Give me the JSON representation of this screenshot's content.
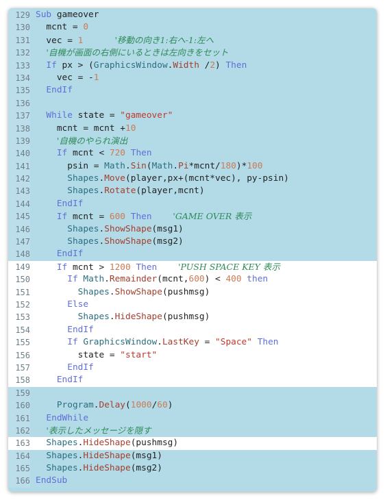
{
  "colors": {
    "background": "#b3dae7",
    "highlight": "#ffffff",
    "keyword": "#5f6fd8",
    "number": "#c97b55",
    "class": "#2b6f80",
    "method": "#a2402e",
    "string": "#c0392b",
    "comment": "#2e8b57"
  },
  "lines": [
    {
      "n": "129",
      "hl": false,
      "t": [
        [
          "kw",
          "Sub"
        ],
        [
          "pl",
          " gameover"
        ]
      ]
    },
    {
      "n": "130",
      "hl": false,
      "t": [
        [
          "pl",
          "  mcnt = "
        ],
        [
          "num",
          "0"
        ]
      ]
    },
    {
      "n": "131",
      "hl": false,
      "t": [
        [
          "pl",
          "  vec = "
        ],
        [
          "num",
          "1"
        ],
        [
          "pl",
          "      "
        ],
        [
          "cm",
          "'移動の向き1:右へ-1:左へ"
        ]
      ]
    },
    {
      "n": "132",
      "hl": false,
      "t": [
        [
          "pl",
          "  "
        ],
        [
          "cm",
          "'自機が画面の右側にいるときは左向きをセット"
        ]
      ]
    },
    {
      "n": "133",
      "hl": false,
      "t": [
        [
          "pl",
          "  "
        ],
        [
          "kw",
          "If"
        ],
        [
          "pl",
          " px > ("
        ],
        [
          "cls",
          "GraphicsWindow"
        ],
        [
          "pl",
          "."
        ],
        [
          "mth",
          "Width"
        ],
        [
          "pl",
          " /"
        ],
        [
          "num",
          "2"
        ],
        [
          "pl",
          ") "
        ],
        [
          "kw",
          "Then"
        ]
      ]
    },
    {
      "n": "134",
      "hl": false,
      "t": [
        [
          "pl",
          "    vec = -"
        ],
        [
          "num",
          "1"
        ]
      ]
    },
    {
      "n": "135",
      "hl": false,
      "t": [
        [
          "pl",
          "  "
        ],
        [
          "kw",
          "EndIf"
        ]
      ]
    },
    {
      "n": "136",
      "hl": false,
      "t": []
    },
    {
      "n": "137",
      "hl": false,
      "t": [
        [
          "pl",
          "  "
        ],
        [
          "kw",
          "While"
        ],
        [
          "pl",
          " state = "
        ],
        [
          "str",
          "\"gameover\""
        ]
      ]
    },
    {
      "n": "138",
      "hl": false,
      "t": [
        [
          "pl",
          "    mcnt = mcnt +"
        ],
        [
          "num",
          "10"
        ]
      ]
    },
    {
      "n": "139",
      "hl": false,
      "t": [
        [
          "pl",
          "    "
        ],
        [
          "cm",
          "'自機のやられ演出"
        ]
      ]
    },
    {
      "n": "140",
      "hl": false,
      "t": [
        [
          "pl",
          "    "
        ],
        [
          "kw",
          "If"
        ],
        [
          "pl",
          " mcnt < "
        ],
        [
          "num",
          "720"
        ],
        [
          "pl",
          " "
        ],
        [
          "kw",
          "Then"
        ]
      ]
    },
    {
      "n": "141",
      "hl": false,
      "t": [
        [
          "pl",
          "      psin = "
        ],
        [
          "cls",
          "Math"
        ],
        [
          "pl",
          "."
        ],
        [
          "mth",
          "Sin"
        ],
        [
          "pl",
          "("
        ],
        [
          "cls",
          "Math"
        ],
        [
          "pl",
          "."
        ],
        [
          "mth",
          "Pi"
        ],
        [
          "pl",
          "*mcnt/"
        ],
        [
          "num",
          "180"
        ],
        [
          "pl",
          ")*"
        ],
        [
          "num",
          "100"
        ]
      ]
    },
    {
      "n": "142",
      "hl": false,
      "t": [
        [
          "pl",
          "      "
        ],
        [
          "cls",
          "Shapes"
        ],
        [
          "pl",
          "."
        ],
        [
          "mth",
          "Move"
        ],
        [
          "pl",
          "(player,px+(mcnt*vec), py-psin)"
        ]
      ]
    },
    {
      "n": "143",
      "hl": false,
      "t": [
        [
          "pl",
          "      "
        ],
        [
          "cls",
          "Shapes"
        ],
        [
          "pl",
          "."
        ],
        [
          "mth",
          "Rotate"
        ],
        [
          "pl",
          "(player,mcnt)"
        ]
      ]
    },
    {
      "n": "144",
      "hl": false,
      "t": [
        [
          "pl",
          "    "
        ],
        [
          "kw",
          "EndIf"
        ]
      ]
    },
    {
      "n": "145",
      "hl": false,
      "t": [
        [
          "pl",
          "    "
        ],
        [
          "kw",
          "If"
        ],
        [
          "pl",
          " mcnt = "
        ],
        [
          "num",
          "600"
        ],
        [
          "pl",
          " "
        ],
        [
          "kw",
          "Then"
        ],
        [
          "pl",
          "    "
        ],
        [
          "cm",
          "'GAME OVER 表示"
        ]
      ]
    },
    {
      "n": "146",
      "hl": false,
      "t": [
        [
          "pl",
          "      "
        ],
        [
          "cls",
          "Shapes"
        ],
        [
          "pl",
          "."
        ],
        [
          "mth",
          "ShowShape"
        ],
        [
          "pl",
          "(msg1)"
        ]
      ]
    },
    {
      "n": "147",
      "hl": false,
      "t": [
        [
          "pl",
          "      "
        ],
        [
          "cls",
          "Shapes"
        ],
        [
          "pl",
          "."
        ],
        [
          "mth",
          "ShowShape"
        ],
        [
          "pl",
          "(msg2)"
        ]
      ]
    },
    {
      "n": "148",
      "hl": false,
      "t": [
        [
          "pl",
          "    "
        ],
        [
          "kw",
          "EndIf"
        ]
      ]
    },
    {
      "n": "149",
      "hl": true,
      "t": [
        [
          "pl",
          "    "
        ],
        [
          "kw",
          "If"
        ],
        [
          "pl",
          " mcnt > "
        ],
        [
          "num",
          "1200"
        ],
        [
          "pl",
          " "
        ],
        [
          "kw",
          "Then"
        ],
        [
          "pl",
          "    "
        ],
        [
          "cm",
          "'PUSH SPACE KEY 表示"
        ]
      ]
    },
    {
      "n": "150",
      "hl": true,
      "t": [
        [
          "pl",
          "      "
        ],
        [
          "kw",
          "If"
        ],
        [
          "pl",
          " "
        ],
        [
          "cls",
          "Math"
        ],
        [
          "pl",
          "."
        ],
        [
          "mth",
          "Remainder"
        ],
        [
          "pl",
          "(mcnt,"
        ],
        [
          "num",
          "600"
        ],
        [
          "pl",
          ") < "
        ],
        [
          "num",
          "400"
        ],
        [
          "pl",
          " "
        ],
        [
          "kw",
          "then"
        ]
      ]
    },
    {
      "n": "151",
      "hl": true,
      "t": [
        [
          "pl",
          "        "
        ],
        [
          "cls",
          "Shapes"
        ],
        [
          "pl",
          "."
        ],
        [
          "mth",
          "ShowShape"
        ],
        [
          "pl",
          "(pushmsg)"
        ]
      ]
    },
    {
      "n": "152",
      "hl": true,
      "t": [
        [
          "pl",
          "      "
        ],
        [
          "kw",
          "Else"
        ]
      ]
    },
    {
      "n": "153",
      "hl": true,
      "t": [
        [
          "pl",
          "        "
        ],
        [
          "cls",
          "Shapes"
        ],
        [
          "pl",
          "."
        ],
        [
          "mth",
          "HideShape"
        ],
        [
          "pl",
          "(pushmsg)"
        ]
      ]
    },
    {
      "n": "154",
      "hl": true,
      "t": [
        [
          "pl",
          "      "
        ],
        [
          "kw",
          "EndIf"
        ]
      ]
    },
    {
      "n": "155",
      "hl": true,
      "t": [
        [
          "pl",
          "      "
        ],
        [
          "kw",
          "If"
        ],
        [
          "pl",
          " "
        ],
        [
          "cls",
          "GraphicsWindow"
        ],
        [
          "pl",
          "."
        ],
        [
          "mth",
          "LastKey"
        ],
        [
          "pl",
          " = "
        ],
        [
          "str",
          "\"Space\""
        ],
        [
          "pl",
          " "
        ],
        [
          "kw",
          "Then"
        ]
      ]
    },
    {
      "n": "156",
      "hl": true,
      "t": [
        [
          "pl",
          "        state = "
        ],
        [
          "str",
          "\"start\""
        ]
      ]
    },
    {
      "n": "157",
      "hl": true,
      "t": [
        [
          "pl",
          "      "
        ],
        [
          "kw",
          "EndIf"
        ]
      ]
    },
    {
      "n": "158",
      "hl": true,
      "t": [
        [
          "pl",
          "    "
        ],
        [
          "kw",
          "EndIf"
        ]
      ]
    },
    {
      "n": "159",
      "hl": false,
      "t": []
    },
    {
      "n": "160",
      "hl": false,
      "t": [
        [
          "pl",
          "    "
        ],
        [
          "cls",
          "Program"
        ],
        [
          "pl",
          "."
        ],
        [
          "mth",
          "Delay"
        ],
        [
          "pl",
          "("
        ],
        [
          "num",
          "1000"
        ],
        [
          "pl",
          "/"
        ],
        [
          "num",
          "60"
        ],
        [
          "pl",
          ")"
        ]
      ]
    },
    {
      "n": "161",
      "hl": false,
      "t": [
        [
          "pl",
          "  "
        ],
        [
          "kw",
          "EndWhile"
        ]
      ]
    },
    {
      "n": "162",
      "hl": false,
      "t": [
        [
          "pl",
          "  "
        ],
        [
          "cm",
          "'表示したメッセージを隠す"
        ]
      ]
    },
    {
      "n": "163",
      "hl": true,
      "t": [
        [
          "pl",
          "  "
        ],
        [
          "cls",
          "Shapes"
        ],
        [
          "pl",
          "."
        ],
        [
          "mth",
          "HideShape"
        ],
        [
          "pl",
          "(pushmsg)"
        ]
      ]
    },
    {
      "n": "164",
      "hl": false,
      "t": [
        [
          "pl",
          "  "
        ],
        [
          "cls",
          "Shapes"
        ],
        [
          "pl",
          "."
        ],
        [
          "mth",
          "HideShape"
        ],
        [
          "pl",
          "(msg1)"
        ]
      ]
    },
    {
      "n": "165",
      "hl": false,
      "t": [
        [
          "pl",
          "  "
        ],
        [
          "cls",
          "Shapes"
        ],
        [
          "pl",
          "."
        ],
        [
          "mth",
          "HideShape"
        ],
        [
          "pl",
          "(msg2)"
        ]
      ]
    },
    {
      "n": "166",
      "hl": false,
      "t": [
        [
          "kw",
          "EndSub"
        ]
      ]
    }
  ]
}
